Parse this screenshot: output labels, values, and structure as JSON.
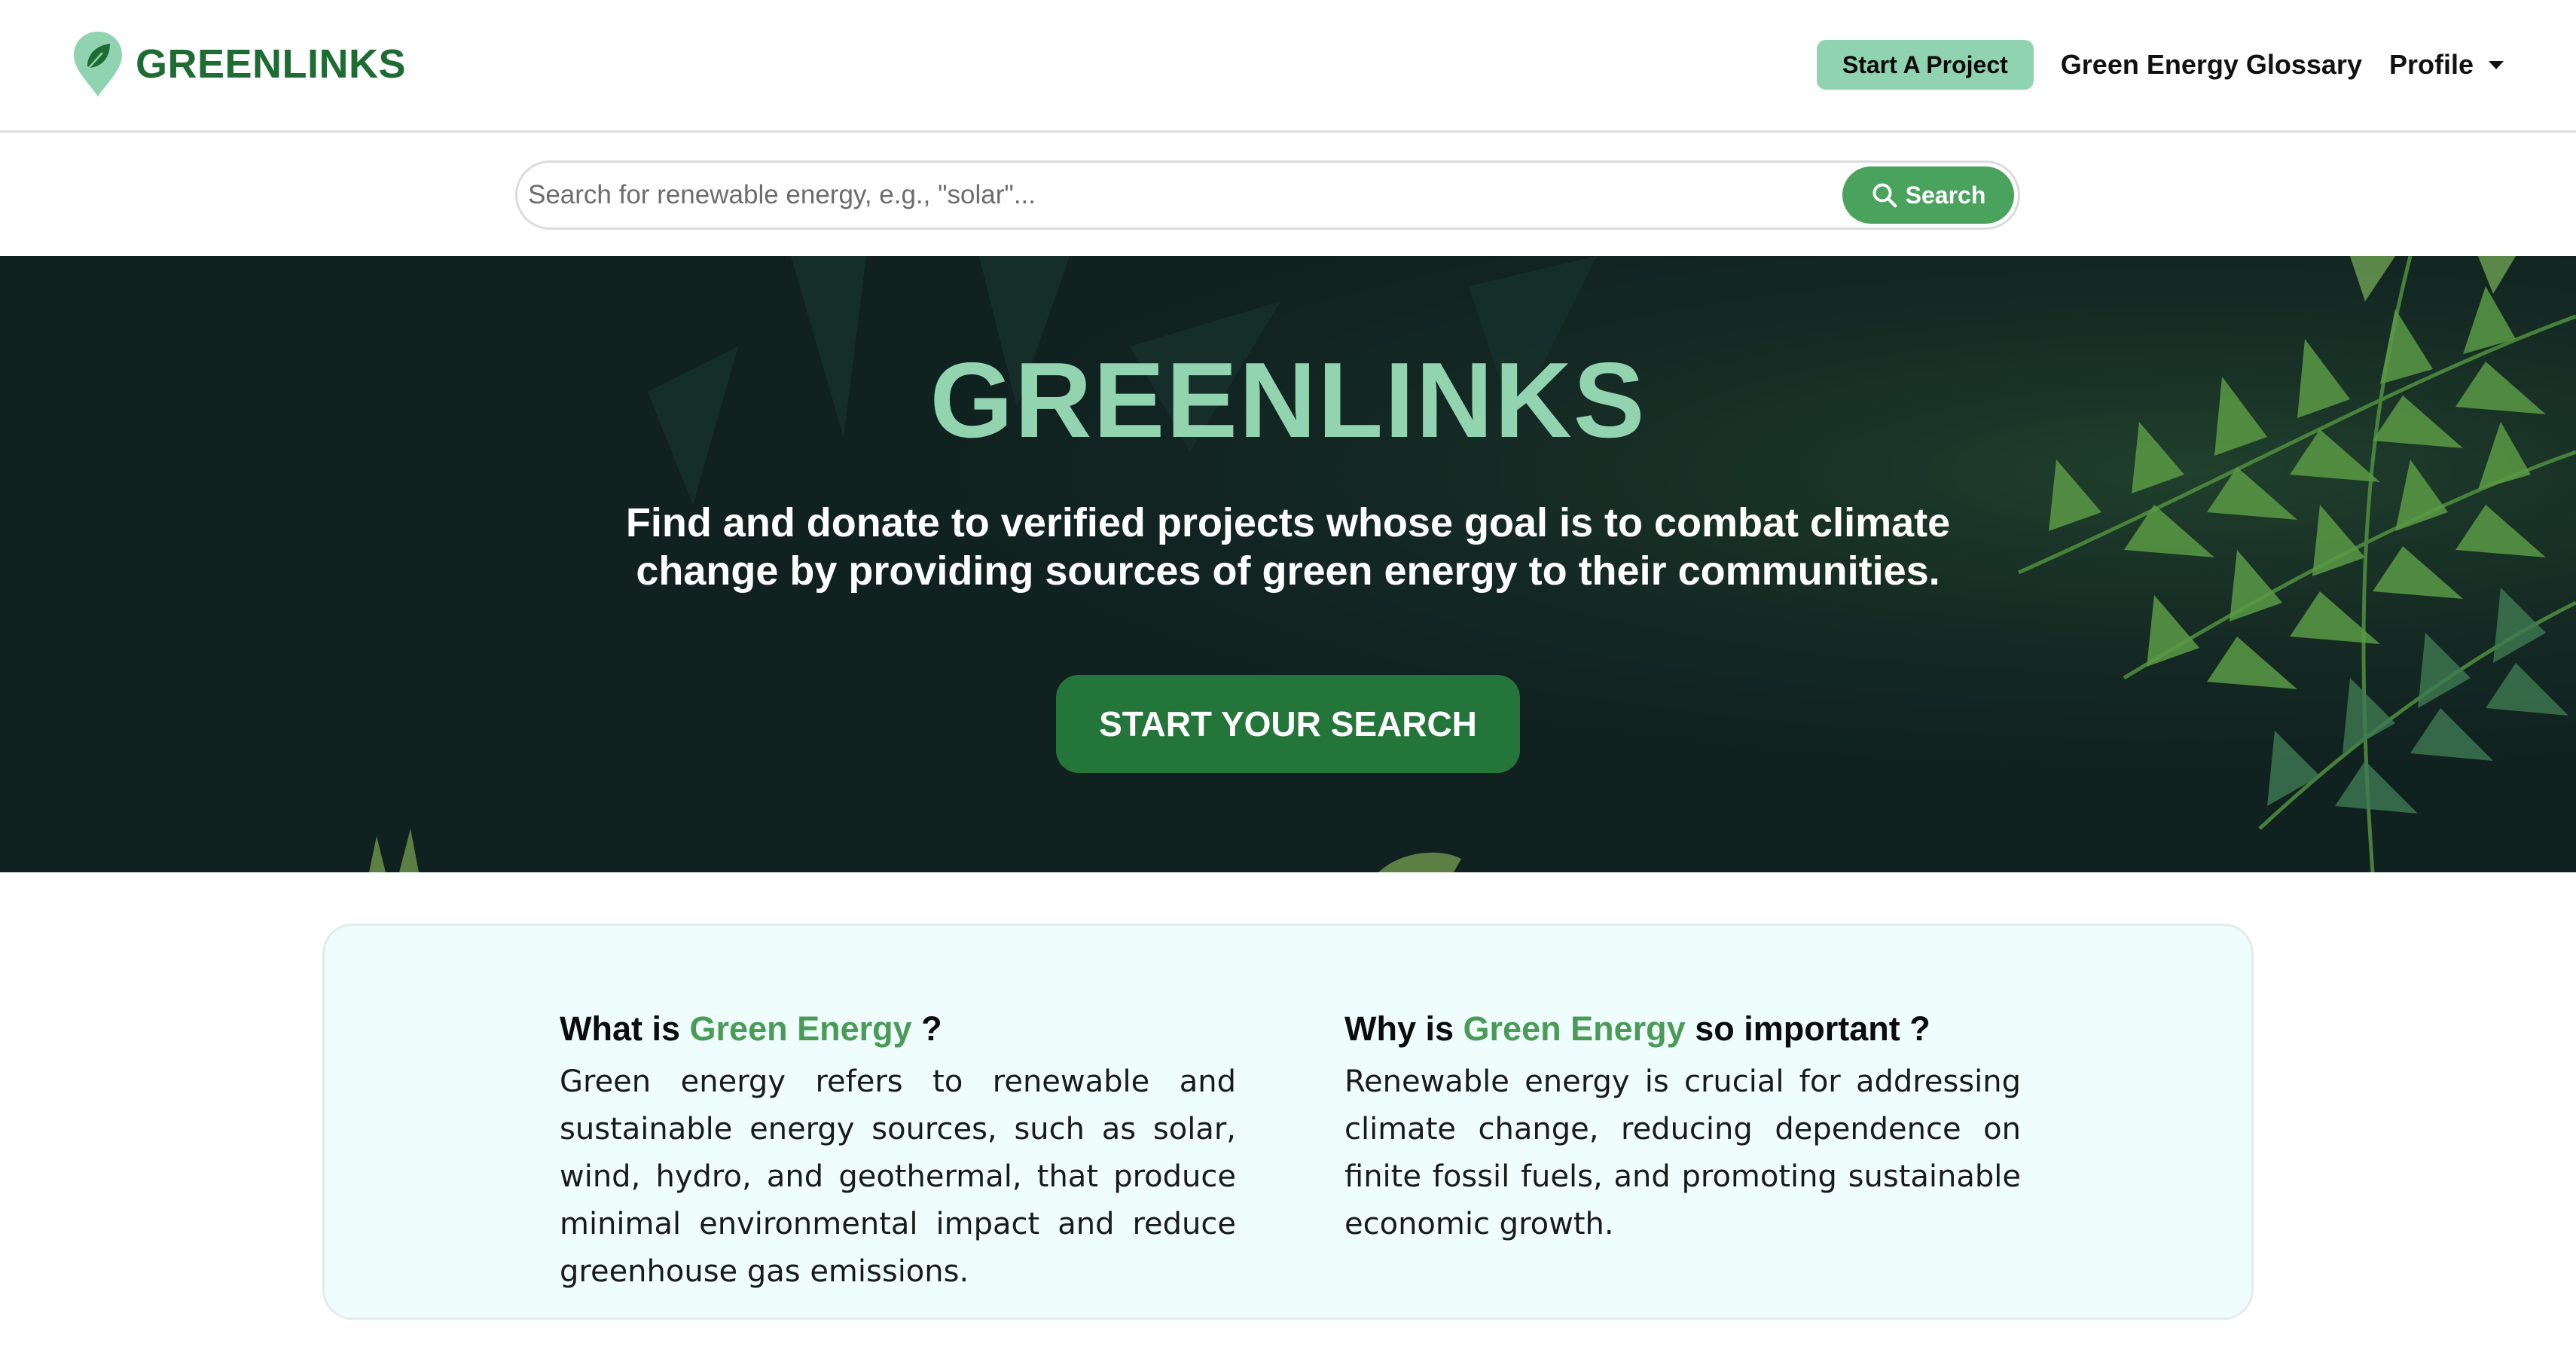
{
  "navbar": {
    "brand": "GREENLINKS",
    "start_project_label": "Start A Project",
    "glossary_label": "Green Energy Glossary",
    "profile_label": "Profile"
  },
  "search": {
    "placeholder": "Search for renewable energy, e.g., \"solar\"...",
    "button_label": "Search"
  },
  "hero": {
    "title": "GREENLINKS",
    "subtitle": "Find and donate to verified projects whose goal is to combat climate change by providing sources of green energy to their communities.",
    "cta_label": "START YOUR SEARCH"
  },
  "info": {
    "what": {
      "heading_prefix": "What is",
      "heading_accent": "Green Energy",
      "heading_suffix": "?",
      "body": "Green energy refers to renewable and sustainable energy sources, such as solar, wind, hydro, and geothermal, that produce minimal environmental impact and reduce greenhouse gas emissions."
    },
    "why": {
      "heading_prefix": "Why is",
      "heading_accent": "Green Energy",
      "heading_suffix": "so important ?",
      "body": "Renewable energy is crucial for addressing climate change, reducing dependence on finite fossil fuels, and promoting sustainable economic growth."
    }
  },
  "colors": {
    "brand_green": "#1f6b34",
    "mint": "#8fd3b0",
    "search_green": "#4aa35d",
    "cta_green": "#23753a",
    "hero_bg": "#102120",
    "card_bg": "#effefd",
    "accent_green": "#4a9b57"
  },
  "icons": {
    "brand": "leaf-pin-icon",
    "search": "search-icon",
    "profile": "caret-down-icon"
  }
}
